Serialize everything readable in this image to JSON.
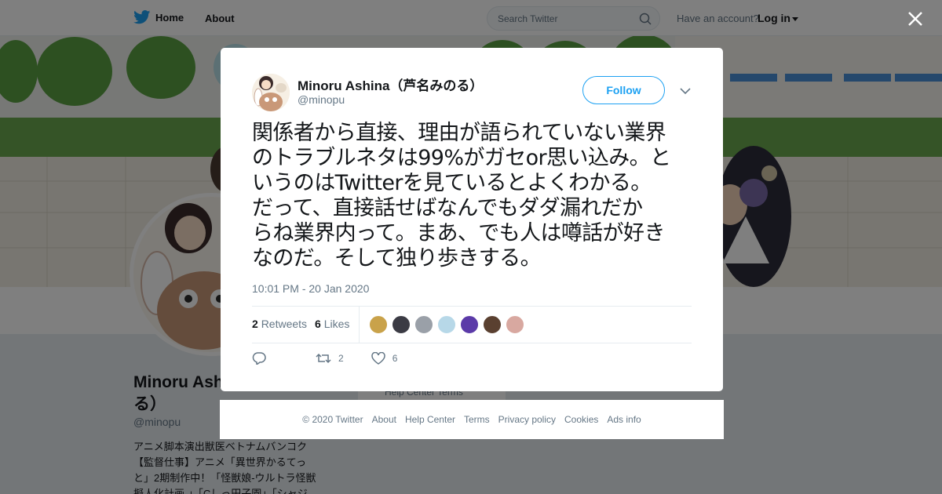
{
  "nav": {
    "home_label": "Home",
    "about_label": "About",
    "search_placeholder": "Search Twitter",
    "have_account": "Have an account?",
    "login_label": "Log in"
  },
  "background_profile": {
    "name_line1": "Minoru Ash",
    "name_line2": "る）",
    "handle": "@minopu",
    "bio": [
      "アニメ脚本演出獣医ベトナムバンコク",
      "【監督仕事】アニメ「異世界かるてっ",
      "と」2期制作中！「怪獣娘-ウルトラ怪獣",
      "擬人化計画-」「Cしっ田子園」「シャジ"
    ],
    "card_text": "Help Center   Terms"
  },
  "tweet": {
    "author_name": "Minoru Ashina（芦名みのる）",
    "author_handle": "@minopu",
    "follow_label": "Follow",
    "text_lines": [
      "関係者から直接、理由が語られていない業界",
      "のトラブルネタは99%がガセor思い込み。と",
      "いうのはTwitterを見ているとよくわかる。",
      "だって、直接話せばなんでもダダ漏れだか",
      "らね業界内って。まあ、でも人は噂話が好き",
      "なのだ。そして独り歩きする。"
    ],
    "timestamp": "10:01 PM - 20 Jan 2020",
    "retweets_count": "2",
    "retweets_label": "Retweets",
    "likes_count": "6",
    "likes_label": "Likes",
    "liker_colors": [
      "#c9a24a",
      "#3b3b44",
      "#9aa0a8",
      "#b7d8e8",
      "#5b3aa8",
      "#5a4030",
      "#d8a8a0"
    ],
    "action_retweet_count": "2",
    "action_like_count": "6"
  },
  "footer": {
    "links": [
      "© 2020 Twitter",
      "About",
      "Help Center",
      "Terms",
      "Privacy policy",
      "Cookies",
      "Ads info"
    ]
  },
  "colors": {
    "brand": "#1da1f2",
    "overlay": "rgba(0,0,0,0.5)"
  }
}
